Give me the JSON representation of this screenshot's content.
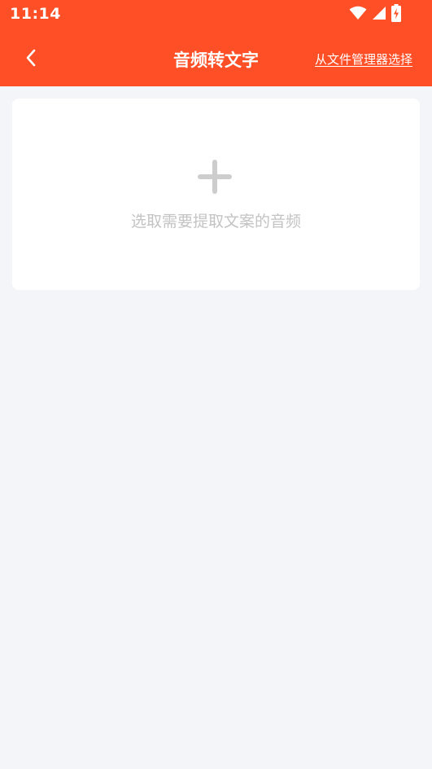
{
  "status_bar": {
    "time": "11:14",
    "icons": [
      "wifi-icon",
      "cellular-signal-icon",
      "battery-charging-icon"
    ]
  },
  "header": {
    "title": "音频转文字",
    "back_icon": "chevron-left-icon",
    "file_manager_label": "从文件管理器选择",
    "background_color": "#ff4f27"
  },
  "upload_card": {
    "icon": "plus-icon",
    "hint": "选取需要提取文案的音频"
  },
  "colors": {
    "accent": "#ff4f27",
    "page_background": "#f4f5f9",
    "card_background": "#ffffff",
    "placeholder_text": "#c3c3c3"
  }
}
